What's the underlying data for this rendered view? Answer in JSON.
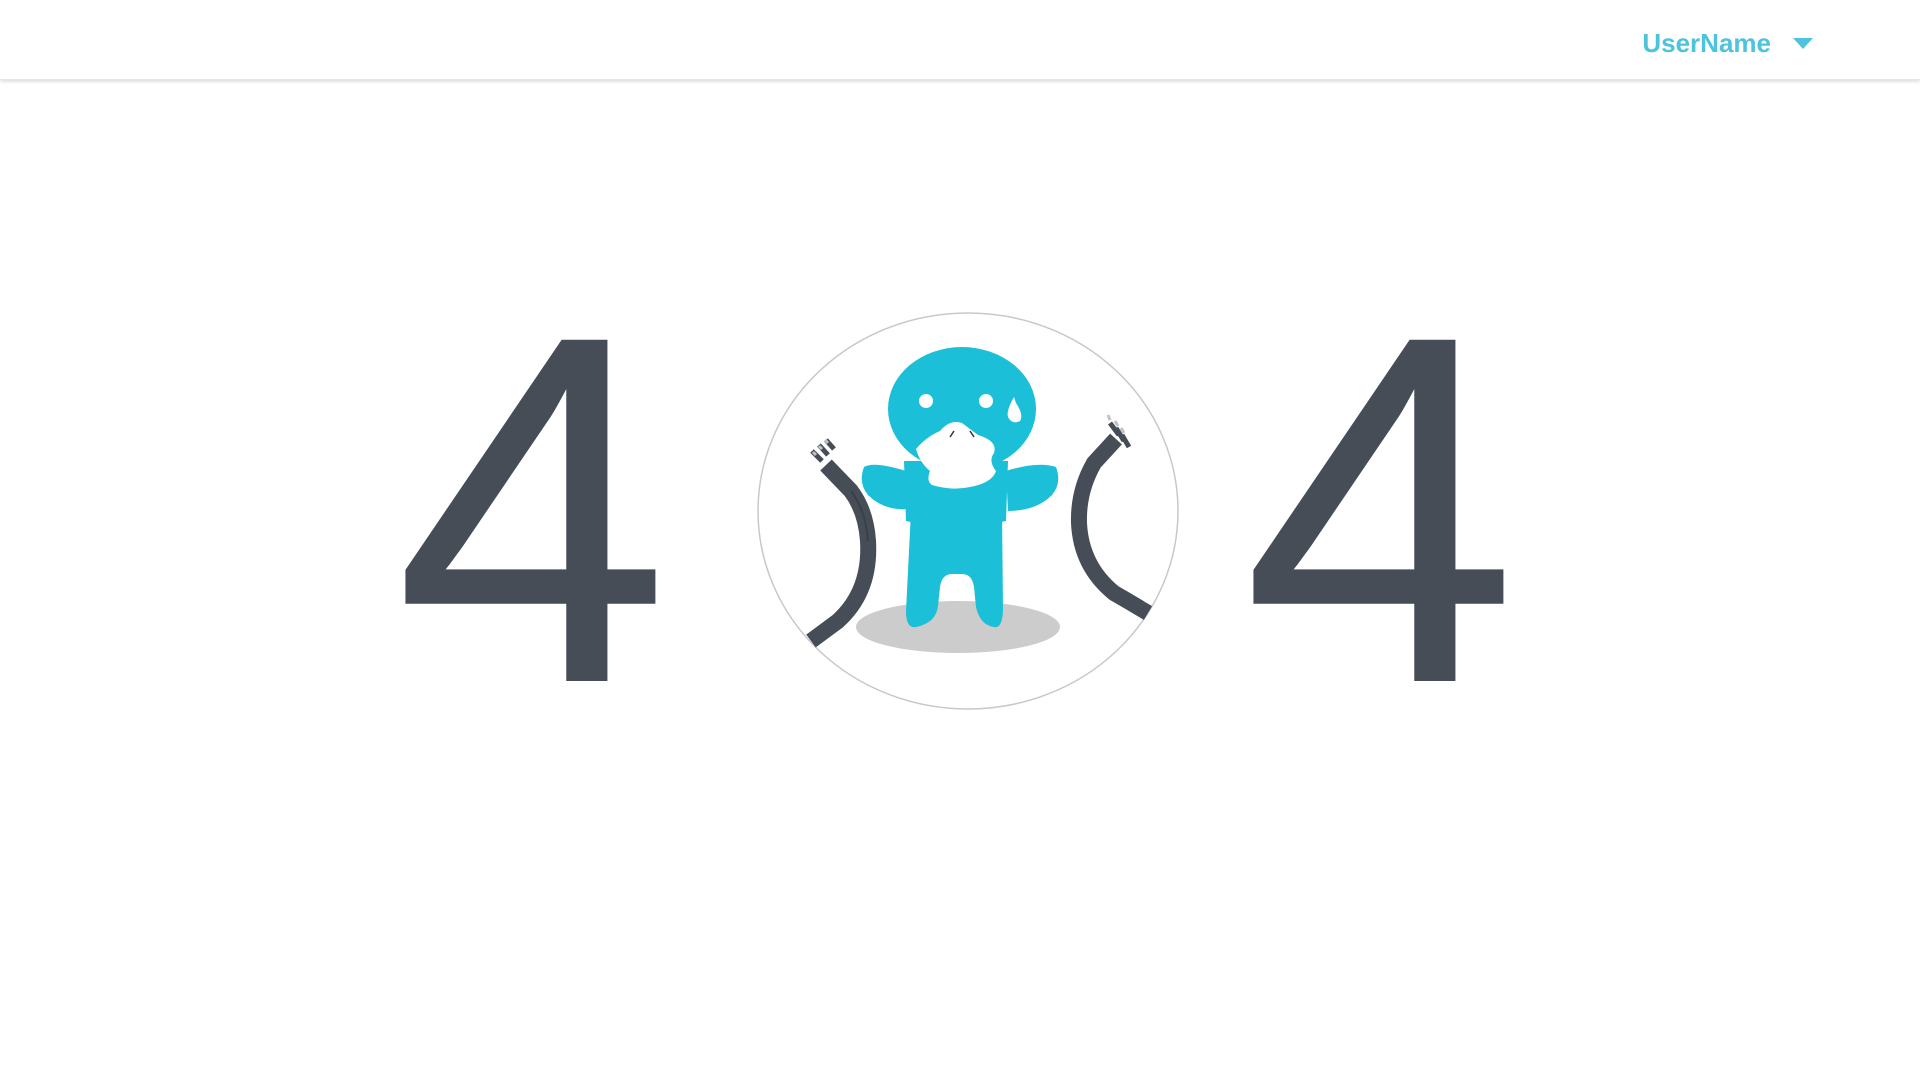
{
  "header": {
    "user_name": "UserName",
    "dropdown_icon": "caret-down-icon"
  },
  "error": {
    "digit_left": "4",
    "digit_right": "4",
    "illustration_icon": "mascot-unplugged-cable-illustration"
  },
  "colors": {
    "accent": "#4dc3dd",
    "digits": "#464d57",
    "mascot": "#1cbfd8",
    "cable": "#464d57",
    "shadow": "#cccccc"
  }
}
